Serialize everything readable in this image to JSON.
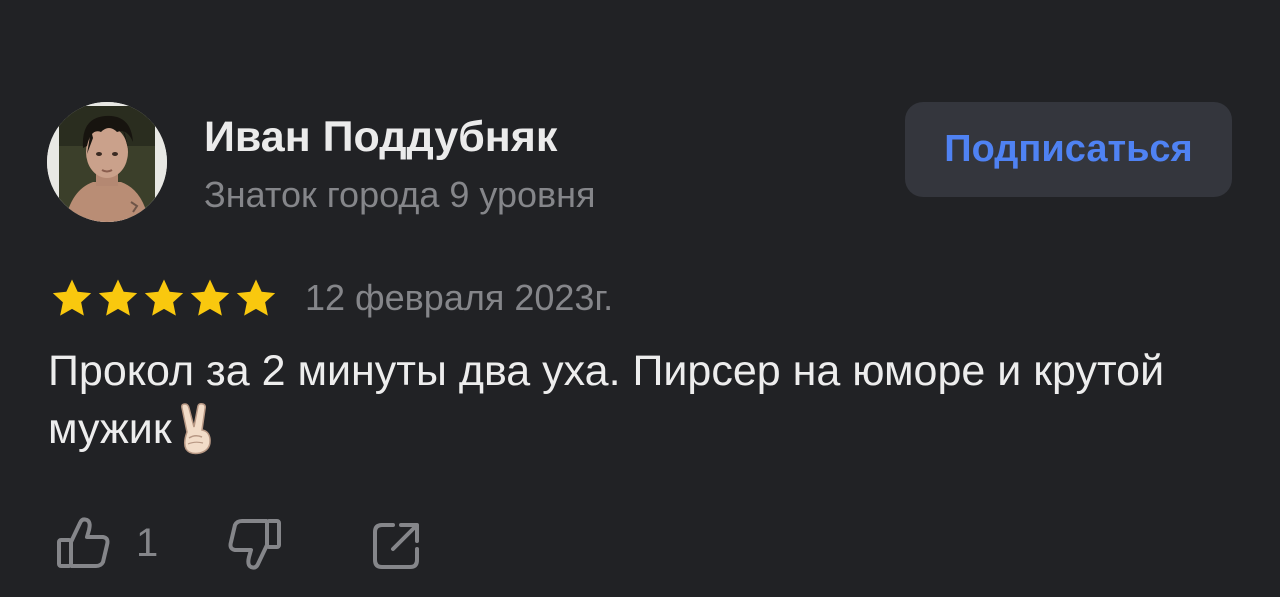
{
  "author": {
    "name": "Иван Поддубняк",
    "level": "Знаток города 9 уровня"
  },
  "subscribe_button": {
    "label": "Подписаться"
  },
  "review": {
    "rating": 5,
    "max_rating": 5,
    "date": "12 февраля 2023г.",
    "text": "Прокол за 2 минуты два уха. Пирсер на юморе и крутой мужик",
    "emoji": "victory-hand-emoji"
  },
  "actions": {
    "like_count": "1",
    "like_icon": "thumbs-up-icon",
    "dislike_icon": "thumbs-down-icon",
    "share_icon": "share-icon"
  },
  "colors": {
    "background": "#212225",
    "accent": "#4f82f3",
    "star": "#f9c80e",
    "muted_text": "#85868a"
  }
}
